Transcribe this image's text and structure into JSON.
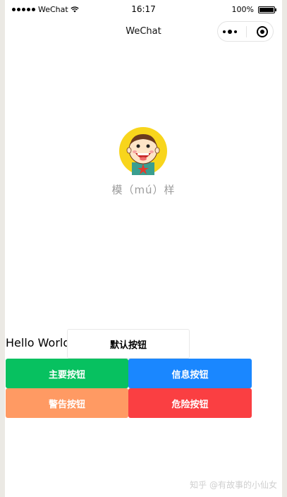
{
  "status_bar": {
    "carrier": "WeChat",
    "time": "16:17",
    "battery": "100%"
  },
  "nav": {
    "title": "WeChat"
  },
  "profile": {
    "caption": "模（mú）样"
  },
  "content": {
    "hello_text": "Hello World",
    "buttons": {
      "default": "默认按钮",
      "primary": "主要按钮",
      "info": "信息按钮",
      "warn": "警告按钮",
      "danger": "危险按钮"
    }
  },
  "watermark": "知乎 @有故事的小仙女",
  "colors": {
    "primary": "#07c160",
    "info": "#1a87ff",
    "warn": "#ff9a63",
    "danger": "#fa3f42"
  }
}
